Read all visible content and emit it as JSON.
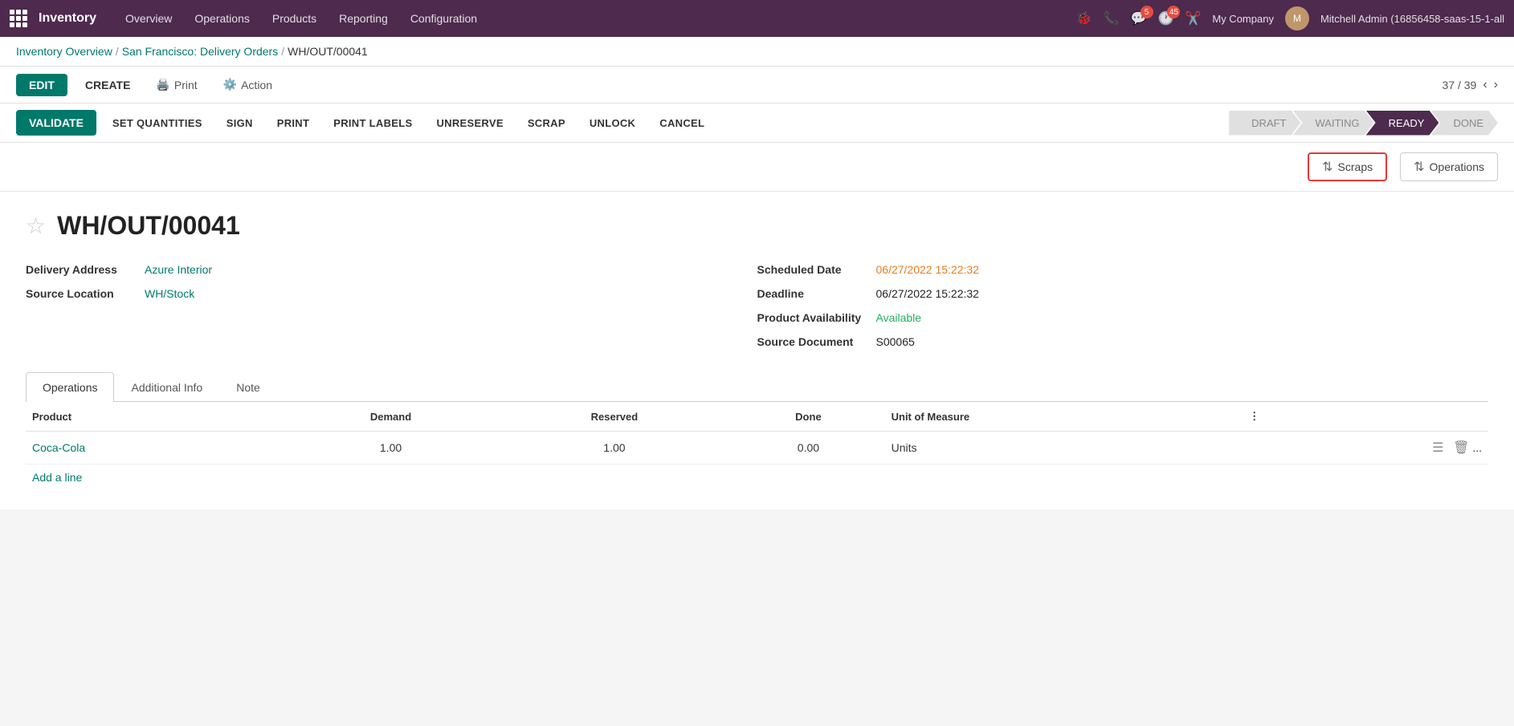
{
  "topnav": {
    "brand": "Inventory",
    "links": [
      "Overview",
      "Operations",
      "Products",
      "Reporting",
      "Configuration"
    ],
    "badge_messages": "5",
    "badge_activity": "45",
    "company": "My Company",
    "user": "Mitchell Admin (16856458-saas-15-1-all"
  },
  "breadcrumb": {
    "parts": [
      "Inventory Overview",
      "San Francisco: Delivery Orders",
      "WH/OUT/00041"
    ],
    "separators": [
      "/",
      "/"
    ]
  },
  "actionbar": {
    "edit_label": "EDIT",
    "create_label": "CREATE",
    "print_label": "Print",
    "action_label": "Action",
    "pagination": "37 / 39"
  },
  "validatebar": {
    "validate_label": "VALIDATE",
    "buttons": [
      "SET QUANTITIES",
      "SIGN",
      "PRINT",
      "PRINT LABELS",
      "UNRESERVE",
      "SCRAP",
      "UNLOCK",
      "CANCEL"
    ],
    "status_steps": [
      "DRAFT",
      "WAITING",
      "READY",
      "DONE"
    ],
    "active_step": "READY"
  },
  "scrapops": {
    "scraps_label": "Scraps",
    "operations_label": "Operations"
  },
  "form": {
    "title": "WH/OUT/00041",
    "delivery_address_label": "Delivery Address",
    "delivery_address_value": "Azure Interior",
    "source_location_label": "Source Location",
    "source_location_value": "WH/Stock",
    "scheduled_date_label": "Scheduled Date",
    "scheduled_date_value": "06/27/2022 15:22:32",
    "deadline_label": "Deadline",
    "deadline_value": "06/27/2022 15:22:32",
    "product_availability_label": "Product Availability",
    "product_availability_value": "Available",
    "source_document_label": "Source Document",
    "source_document_value": "S00065"
  },
  "tabs": [
    "Operations",
    "Additional Info",
    "Note"
  ],
  "active_tab": "Operations",
  "table": {
    "headers": [
      "Product",
      "Demand",
      "Reserved",
      "Done",
      "Unit of Measure",
      ""
    ],
    "rows": [
      {
        "product": "Coca-Cola",
        "demand": "1.00",
        "reserved": "1.00",
        "done": "0.00",
        "unit": "Units"
      }
    ],
    "add_line_label": "Add a line"
  }
}
